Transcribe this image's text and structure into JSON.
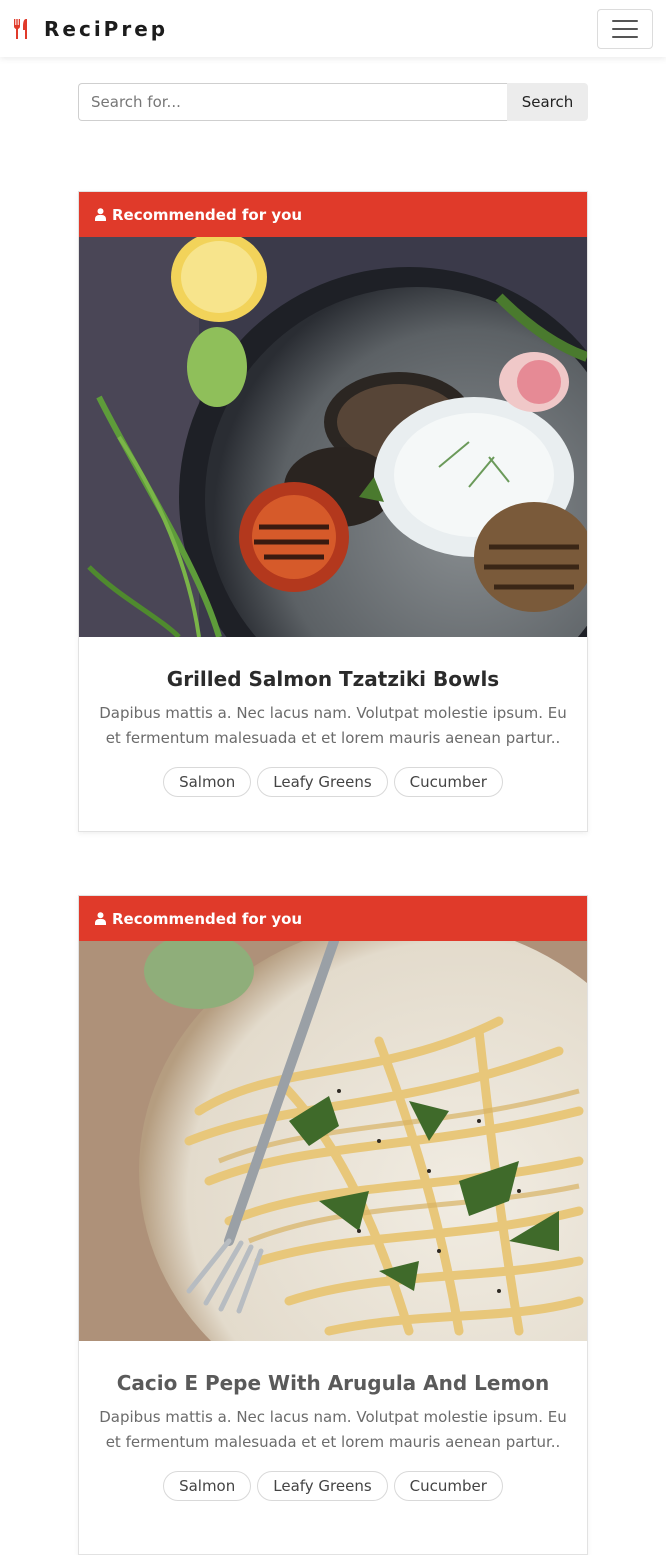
{
  "brand": {
    "name": "ReciPrep",
    "icon": "fork-knife-icon",
    "accent": "#e03a2a"
  },
  "search": {
    "placeholder": "Search for...",
    "button_label": "Search"
  },
  "cards": [
    {
      "header": "Recommended for you",
      "image": "grilled-salmon-bowl-image",
      "title": "Grilled Salmon Tzatziki Bowls",
      "description": "Dapibus mattis a. Nec lacus nam. Volutpat molestie ipsum. Eu et fermentum malesuada et et lorem mauris aenean partur..",
      "tags": [
        "Salmon",
        "Leafy Greens",
        "Cucumber"
      ]
    },
    {
      "header": "Recommended for you",
      "image": "cacio-e-pepe-image",
      "title": "Cacio E Pepe With Arugula And Lemon",
      "description": "Dapibus mattis a. Nec lacus nam. Volutpat molestie ipsum. Eu et fermentum malesuada et et lorem mauris aenean partur..",
      "tags": [
        "Salmon",
        "Leafy Greens",
        "Cucumber"
      ]
    }
  ]
}
